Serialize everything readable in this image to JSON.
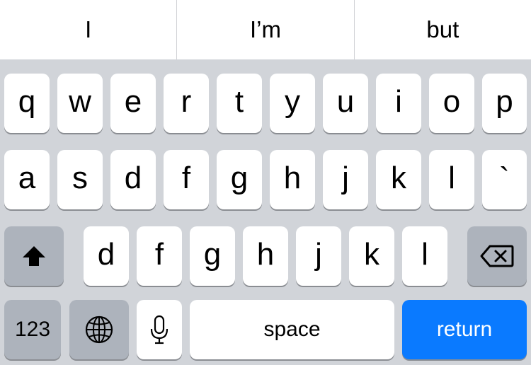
{
  "suggestions": [
    "I",
    "I’m",
    "but"
  ],
  "rows": {
    "row1": [
      "q",
      "w",
      "e",
      "r",
      "t",
      "y",
      "u",
      "i",
      "o",
      "p"
    ],
    "row2": [
      "a",
      "s",
      "d",
      "f",
      "g",
      "h",
      "j",
      "k",
      "l",
      "`"
    ],
    "row3": [
      "d",
      "f",
      "g",
      "h",
      "j",
      "k",
      "l"
    ]
  },
  "bottom": {
    "numbers_label": "123",
    "space_label": "space",
    "return_label": "return"
  },
  "icons": {
    "shift": "shift-arrow-icon",
    "delete": "delete-backspace-icon",
    "globe": "globe-icon",
    "mic": "microphone-icon"
  },
  "colors": {
    "keyboard_background": "#d1d4d9",
    "key_background": "#ffffff",
    "function_key_background": "#adb3bc",
    "return_key_background": "#0a7aff"
  }
}
